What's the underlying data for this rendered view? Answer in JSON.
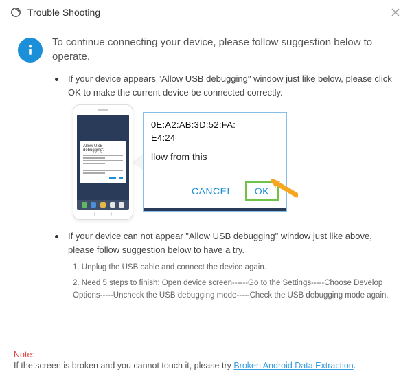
{
  "titlebar": {
    "title": "Trouble Shooting"
  },
  "headline": "To continue connecting your device, please follow suggestion below to operate.",
  "bullet1": "If your device appears \"Allow USB debugging\" window just like below, please click OK to make the current device  be connected correctly.",
  "bullet2": "If your device can not appear \"Allow USB debugging\" window just like above, please follow suggestion below to have a try.",
  "phone_dialog": {
    "title": "Allow USB debugging?"
  },
  "zoom": {
    "mac_line1": "0E:A2:AB:3D:52:FA:",
    "mac_line2": "E4:24",
    "allow_text": "llow from this",
    "cancel": "CANCEL",
    "ok": "OK"
  },
  "steps": {
    "s1": "1. Unplug the USB cable and connect the device again.",
    "s2": "2. Need 5 steps to finish: Open device screen------Go to the Settings-----Choose Develop Options-----Uncheck the USB debugging mode-----Check the USB debugging mode again."
  },
  "footer": {
    "note_label": "Note:",
    "text_before": "If the screen is broken and you cannot touch it, please try ",
    "link": "Broken Android Data Extraction",
    "text_after": "."
  }
}
